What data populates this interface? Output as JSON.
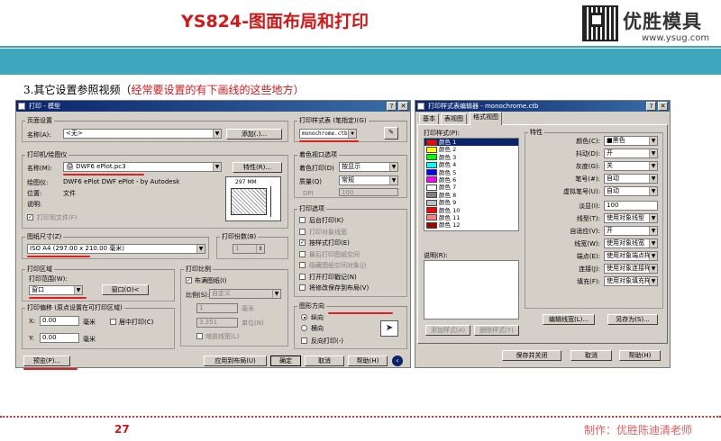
{
  "header": {
    "title": "YS824-图面布局和打印",
    "brand": "优胜模具",
    "brand_url": "www.ysug.com"
  },
  "subtitle": {
    "prefix": "3.其它设置参照视频（",
    "red": "经常要设置的有下画线的这些地方）"
  },
  "footer": {
    "page": "27",
    "maker": "制作：优胜陈迪清老师"
  },
  "colors": {
    "accent_red": "#d01818",
    "teal": "#3fa7bd",
    "titlebar": "#0a246a"
  },
  "plot_dialog": {
    "title": "打印 - 模型",
    "page_setup": {
      "group": "页面设置",
      "name_label": "名称(A):",
      "name_value": "<无>",
      "add_button": "添加(.)..."
    },
    "printer": {
      "group": "打印机/绘图仪",
      "name_label": "名称(M):",
      "name_value": "DWF6 ePlot.pc3",
      "properties_button": "特性(R)...",
      "plotter_label": "绘图仪:",
      "plotter_value": "DWF6 ePlot DWF ePlot - by Autodesk",
      "location_label": "位置:",
      "location_value": "文件",
      "description_label": "说明:",
      "plot_to_file": "打印到文件(F)",
      "preview_dim": "297 MM"
    },
    "paper_size": {
      "group": "图纸尺寸(Z)",
      "value": "ISO A4 (297.00 x 210.00 毫米)"
    },
    "copies": {
      "group": "打印份数(B)",
      "value": "1"
    },
    "plot_area": {
      "group": "打印区域",
      "range_label": "打印范围(W):",
      "range_value": "窗口",
      "window_button": "窗口(O)<"
    },
    "plot_scale": {
      "group": "打印比例",
      "fit_label": "布满图纸(I)",
      "scale_label": "比例(S):",
      "scale_value": "自定义",
      "val1": "1",
      "unit1": "毫米",
      "val2": "3.351",
      "unit2": "单位(N)",
      "scale_lineweights": "缩放线宽(L)"
    },
    "plot_offset": {
      "group": "打印偏移 (原点设置在可打印区域)",
      "x_label": "X:",
      "x_value": "0.00",
      "x_unit": "毫米",
      "center_label": "居中打印(C)",
      "y_label": "Y:",
      "y_value": "0.00",
      "y_unit": "毫米"
    },
    "plot_style": {
      "group": "打印样式表 (笔指定)(G)",
      "value": "monochrome.ctb"
    },
    "shaded": {
      "group": "着色视口选项",
      "shade_label": "着色打印(D)",
      "shade_value": "按显示",
      "quality_label": "质量(Q)",
      "quality_value": "常规",
      "dpi_label": "DPI",
      "dpi_value": "100"
    },
    "options": {
      "group": "打印选项",
      "items": [
        "后台打印(K)",
        "打印对象线宽",
        "按样式打印(E)",
        "最后打印图纸空间",
        "隐藏图纸空间对象(J)",
        "打开打印戳记(N)",
        "将修改保存到布局(V)"
      ]
    },
    "orientation": {
      "group": "图形方向",
      "portrait": "纵向",
      "landscape": "横向",
      "upside_down": "反向打印(-)"
    },
    "buttons": {
      "preview": "预览(P)...",
      "apply": "应用到布局(U)",
      "ok": "确定",
      "cancel": "取消",
      "help": "帮助(H)"
    }
  },
  "editor_dialog": {
    "title": "打印样式表编辑器 - monochrome.ctb",
    "tabs": [
      "基本",
      "表视图",
      "格式视图"
    ],
    "styles_label": "打印样式(P):",
    "styles": [
      {
        "name": "颜色 1",
        "color": "#ff0000"
      },
      {
        "name": "颜色 2",
        "color": "#ffff00"
      },
      {
        "name": "颜色 3",
        "color": "#00ff00"
      },
      {
        "name": "颜色 4",
        "color": "#00ffff"
      },
      {
        "name": "颜色 5",
        "color": "#0000ff"
      },
      {
        "name": "颜色 6",
        "color": "#ff00ff"
      },
      {
        "name": "颜色 7",
        "color": "#ffffff"
      },
      {
        "name": "颜色 8",
        "color": "#808080"
      },
      {
        "name": "颜色 9",
        "color": "#c0c0c0"
      },
      {
        "name": "颜色 10",
        "color": "#ff0000"
      },
      {
        "name": "颜色 11",
        "color": "#ff7f7f"
      },
      {
        "name": "颜色 12",
        "color": "#a50000"
      }
    ],
    "description_label": "说明(R):",
    "properties": {
      "group": "特性",
      "rows": [
        {
          "label": "颜色(C):",
          "value": "■黑色"
        },
        {
          "label": "抖动(D):",
          "value": "开"
        },
        {
          "label": "灰度(G):",
          "value": "关"
        },
        {
          "label": "笔号(#):",
          "value": "自动"
        },
        {
          "label": "虚拟笔号(U):",
          "value": "自动"
        },
        {
          "label": "淡显(I):",
          "value": "100"
        },
        {
          "label": "线型(T):",
          "value": "使用对象线型"
        },
        {
          "label": "自适应(V):",
          "value": "开"
        },
        {
          "label": "线宽(W):",
          "value": "使用对象线宽"
        },
        {
          "label": "端点(E):",
          "value": "使用对象端点样式"
        },
        {
          "label": "连接(J):",
          "value": "使用对象连接样式"
        },
        {
          "label": "填充(F):",
          "value": "使用对象填充样式"
        }
      ]
    },
    "buttons": {
      "add_style": "添加样式(A)",
      "delete_style": "删除样式(Y)",
      "edit_lineweights": "编辑线宽(L)...",
      "save_as": "另存为(S)...",
      "save_close": "保存并关闭",
      "cancel": "取消",
      "help": "帮助(H)"
    }
  }
}
